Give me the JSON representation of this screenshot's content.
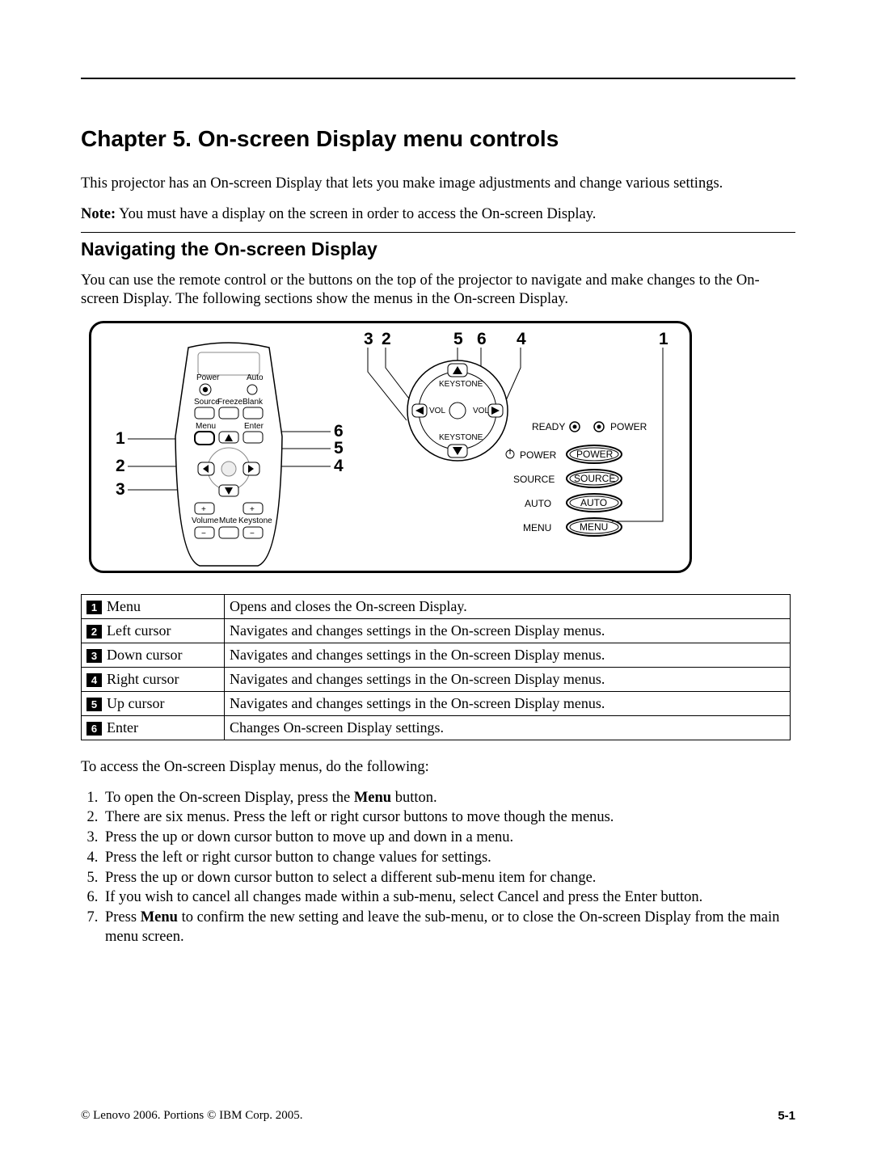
{
  "chapter_title": "Chapter 5. On-screen Display menu controls",
  "intro": "This projector has an On-screen Display that lets you make image adjustments and change various settings.",
  "note_label": "Note:",
  "note_text": " You must have a display on the screen in order to access the On-screen Display.",
  "section_title": "Navigating the On-screen Display",
  "section_intro": "You can use the remote control or the buttons on the top of the projector to navigate and make changes to the On-screen Display. The following sections show the menus in the On-screen Display.",
  "figure": {
    "top_callouts": [
      "3",
      "2",
      "5",
      "6",
      "4",
      "1"
    ],
    "left_callouts": [
      "1",
      "2",
      "3"
    ],
    "mid_callouts": [
      "6",
      "5",
      "4"
    ],
    "remote_labels": {
      "power": "Power",
      "auto": "Auto",
      "source": "Source",
      "freeze": "Freeze",
      "blank": "Blank",
      "menu": "Menu",
      "enter": "Enter",
      "volume": "Volume",
      "mute": "Mute",
      "keystone": "Keystone"
    },
    "wheel_labels": {
      "keystone_top": "KEYSTONE",
      "keystone_bottom": "KEYSTONE",
      "vol_left": "VOL",
      "vol_right": "VOL"
    },
    "panel_leds": {
      "ready": "READY",
      "power_led": "POWER"
    },
    "panel_rows": [
      {
        "label": "POWER",
        "button": "POWER"
      },
      {
        "label": "SOURCE",
        "button": "SOURCE"
      },
      {
        "label": "AUTO",
        "button": "AUTO"
      },
      {
        "label": "MENU",
        "button": "MENU"
      }
    ]
  },
  "table_rows": [
    {
      "num": "1",
      "name": "Menu",
      "desc": "Opens and closes the On-screen Display."
    },
    {
      "num": "2",
      "name": "Left cursor",
      "desc": "Navigates and changes settings in the On-screen Display menus."
    },
    {
      "num": "3",
      "name": "Down cursor",
      "desc": "Navigates and changes settings in the On-screen Display menus."
    },
    {
      "num": "4",
      "name": "Right cursor",
      "desc": "Navigates and changes settings in the On-screen Display menus."
    },
    {
      "num": "5",
      "name": "Up cursor",
      "desc": "Navigates and changes settings in the On-screen Display menus."
    },
    {
      "num": "6",
      "name": "Enter",
      "desc": "Changes On-screen Display settings."
    }
  ],
  "steps_intro": "To access the On-screen Display menus, do the following:",
  "steps": [
    {
      "pre": "To open the On-screen Display, press the ",
      "bold": "Menu",
      "post": " button."
    },
    {
      "pre": "There are six menus. Press the left or right cursor buttons to move though the menus.",
      "bold": "",
      "post": ""
    },
    {
      "pre": "Press the up or down cursor button to move up and down in a menu.",
      "bold": "",
      "post": ""
    },
    {
      "pre": "Press the left or right cursor button to change values for settings.",
      "bold": "",
      "post": ""
    },
    {
      "pre": "Press the up or down cursor button to select a different sub-menu item for change.",
      "bold": "",
      "post": ""
    },
    {
      "pre": "If you wish to cancel all changes made within a sub-menu, select Cancel and press the Enter button.",
      "bold": "",
      "post": ""
    },
    {
      "pre": "Press ",
      "bold": "Menu",
      "post": " to confirm the new setting and leave the sub-menu, or to close the On-screen Display from the main menu screen."
    }
  ],
  "footer_left": "© Lenovo 2006. Portions © IBM Corp. 2005.",
  "footer_right": "5-1"
}
